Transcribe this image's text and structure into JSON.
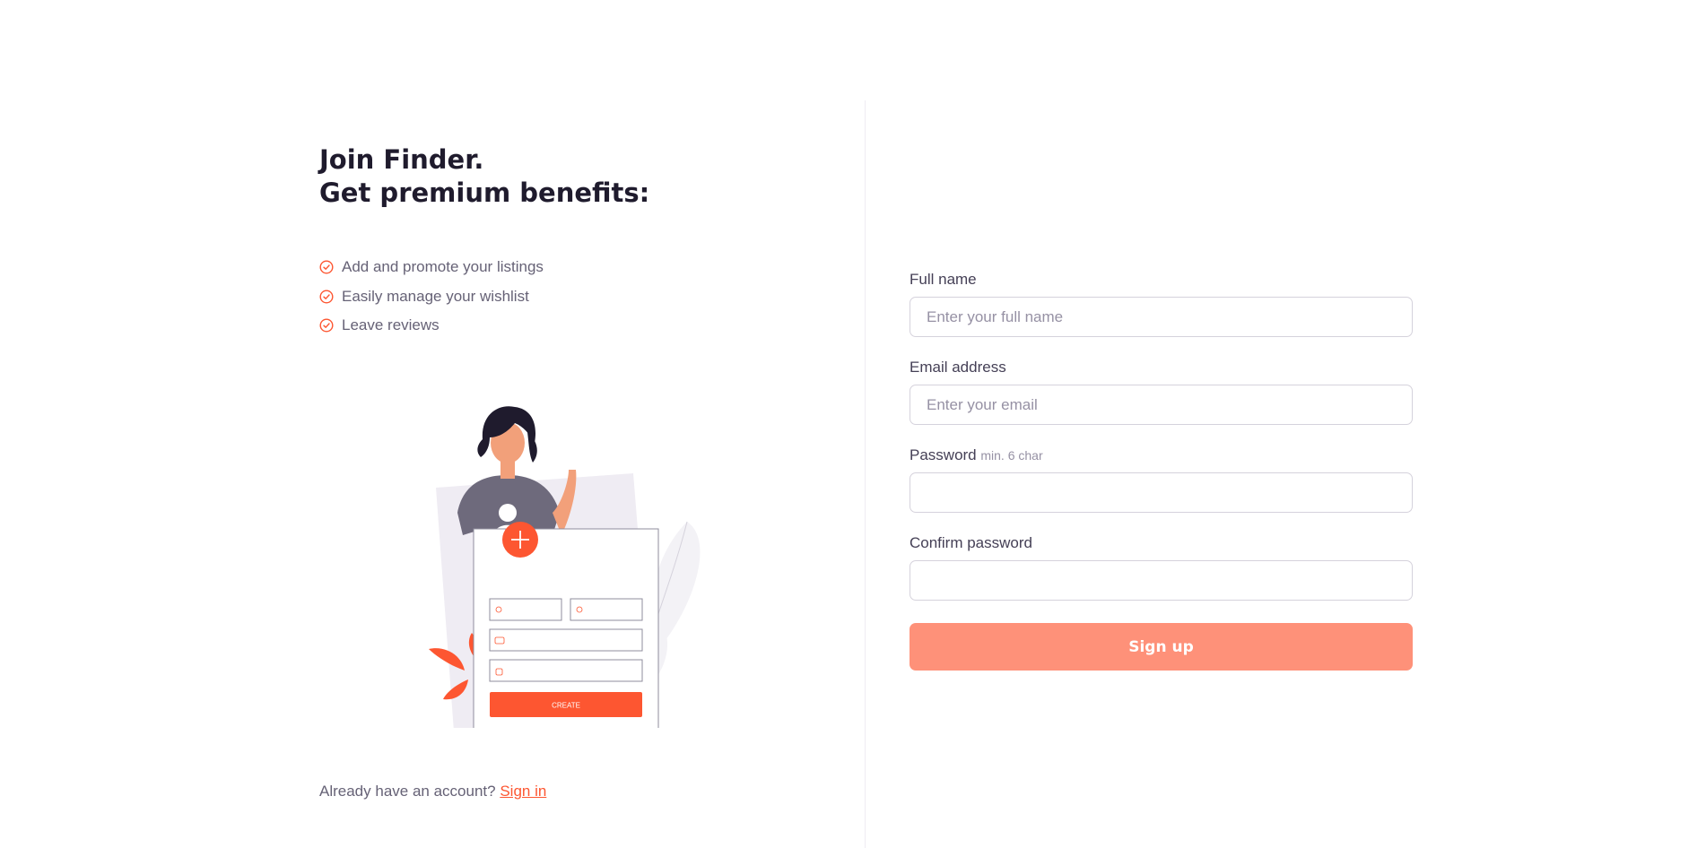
{
  "heading": {
    "line1": "Join Finder.",
    "line2": "Get premium benefits:"
  },
  "benefits": [
    {
      "label": "Add and promote your listings",
      "icon": "check-circle-icon"
    },
    {
      "label": "Easily manage your wishlist",
      "icon": "check-circle-icon"
    },
    {
      "label": "Leave reviews",
      "icon": "check-circle-icon"
    }
  ],
  "illustration": {
    "button_label": "CREATE"
  },
  "account": {
    "prompt": "Already have an account?",
    "link": "Sign in"
  },
  "form": {
    "full_name": {
      "label": "Full name",
      "placeholder": "Enter your full name",
      "value": ""
    },
    "email": {
      "label": "Email address",
      "placeholder": "Enter your email",
      "value": ""
    },
    "password": {
      "label": "Password",
      "hint": "min. 6 char",
      "value": ""
    },
    "confirm_password": {
      "label": "Confirm password",
      "value": ""
    },
    "submit_label": "Sign up"
  },
  "colors": {
    "accent": "#fd5631",
    "button_disabled": "#fe9179",
    "text_dark": "#1f1b2d",
    "text_muted": "#666276"
  }
}
